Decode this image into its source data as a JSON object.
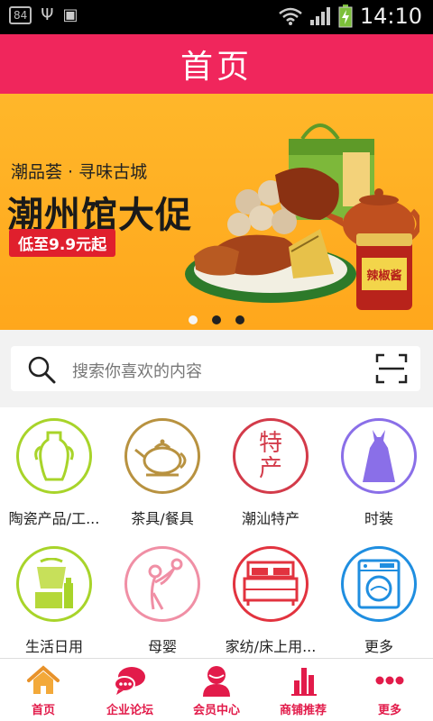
{
  "status_bar": {
    "badge": "84",
    "time": "14:10"
  },
  "header": {
    "title": "首页"
  },
  "banner": {
    "subtitle": "潮品荟 · 寻味古城",
    "headline": "潮州馆大促",
    "promo": "低至9.9元起",
    "jar_label": "辣椒酱",
    "dots": 3,
    "active_dot": 0
  },
  "search": {
    "placeholder": "搜索你喜欢的内容"
  },
  "categories": [
    {
      "label": "陶瓷产品/工...",
      "color": "#a8d42a",
      "icon": "vase-icon"
    },
    {
      "label": "茶具/餐具",
      "color": "#b89240",
      "icon": "teapot-icon"
    },
    {
      "label": "潮汕特产",
      "color": "#d33b4a",
      "icon": "specialty-icon",
      "glyph_top": "特",
      "glyph_bottom": "产"
    },
    {
      "label": "时装",
      "color": "#8a6fe8",
      "icon": "dress-icon"
    },
    {
      "label": "生活日用",
      "color": "#a8d42a",
      "icon": "household-icon"
    },
    {
      "label": "母婴",
      "color": "#f08fa5",
      "icon": "mother-baby-icon"
    },
    {
      "label": "家纺/床上用...",
      "color": "#e2333f",
      "icon": "bed-icon"
    },
    {
      "label": "更多",
      "color": "#1f8ee0",
      "icon": "washing-machine-icon"
    }
  ],
  "tabbar": {
    "accent": "#e21b4a",
    "items": [
      {
        "label": "首页",
        "icon": "home-icon"
      },
      {
        "label": "企业论坛",
        "icon": "forum-icon"
      },
      {
        "label": "会员中心",
        "icon": "member-icon"
      },
      {
        "label": "商铺推荐",
        "icon": "chart-icon"
      },
      {
        "label": "更多",
        "icon": "more-icon"
      }
    ]
  }
}
